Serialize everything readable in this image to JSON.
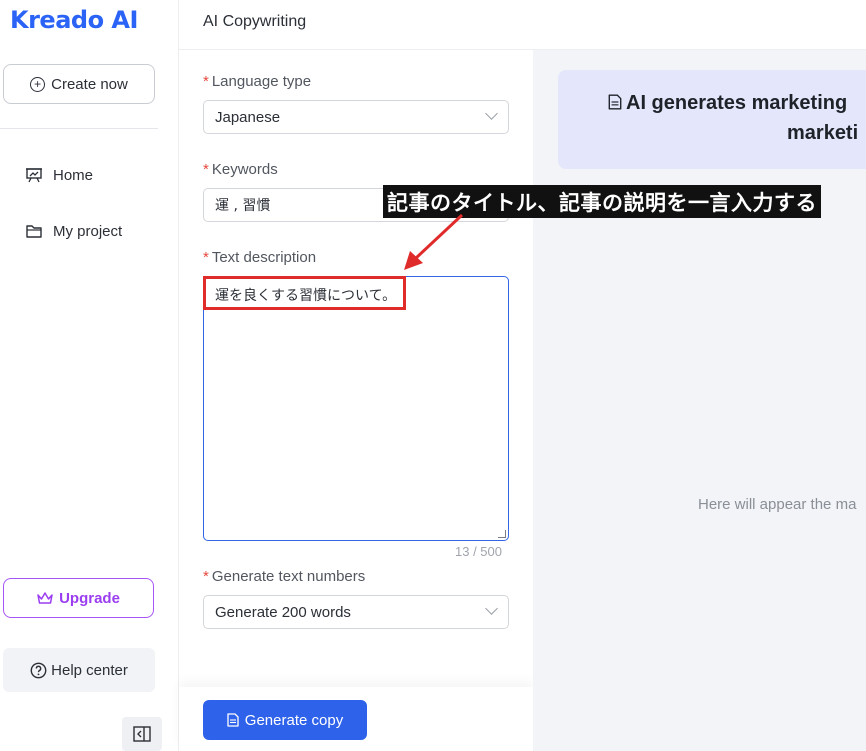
{
  "sidebar": {
    "logo": "Kreado AI",
    "create_label": "Create now",
    "nav": [
      {
        "label": "Home",
        "icon": "presentation-icon"
      },
      {
        "label": "My project",
        "icon": "folder-icon"
      }
    ],
    "upgrade_label": "Upgrade",
    "help_label": "Help center"
  },
  "header": {
    "title": "AI Copywriting"
  },
  "form": {
    "language": {
      "label": "Language type",
      "value": "Japanese"
    },
    "keywords": {
      "label": "Keywords",
      "value": "運 , 習慣"
    },
    "description": {
      "label": "Text description",
      "value": "運を良くする習慣について。",
      "counter": "13 / 500"
    },
    "numbers": {
      "label": "Generate text numbers",
      "value": "Generate 200 words"
    },
    "generate_label": "Generate copy"
  },
  "preview": {
    "banner_line1": "AI generates marketing",
    "banner_line2": "marketi",
    "placeholder": "Here will appear the ma"
  },
  "annotation": {
    "text": "記事のタイトル、記事の説明を一言入力する"
  },
  "colors": {
    "brand": "#2a63f6",
    "accent_button": "#2f62ea",
    "upgrade": "#a855f7",
    "required": "#e5483d",
    "annotation_red": "#e02b2b"
  }
}
